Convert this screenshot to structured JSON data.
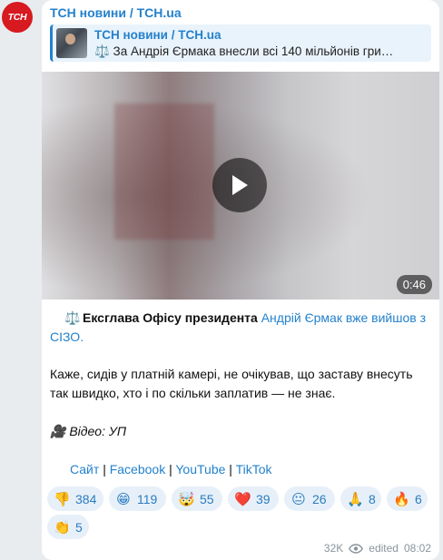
{
  "channel": {
    "avatar_text": "ТСН",
    "name": "ТСН новини / TCH.ua",
    "brand_color": "#d71920",
    "accent_color": "#2481cc"
  },
  "reply": {
    "title": "ТСН новини / TCH.ua",
    "text": "⚖️ За Андрія Єрмака внесли всі 140 мільйонів гри…"
  },
  "video": {
    "duration": "0:46",
    "play_icon": "play-icon"
  },
  "caption": {
    "line1_emoji": "⚖️",
    "line1_bold": "Ексглава Офісу президента",
    "line1_link": "Андрій Єрмак вже вийшов з СІЗО.",
    "paragraph": "Каже, сидів у платній камері, не очікував, що заставу внесуть так швидко, хто і по скільки заплатив — не знає.",
    "video_emoji": "🎥",
    "video_credit": "Відео: УП",
    "links": [
      "Сайт",
      "Facebook",
      "YouTube",
      "TikTok"
    ],
    "separator": "|"
  },
  "reactions": [
    {
      "emoji": "👎",
      "count": "384"
    },
    {
      "emoji": "😁",
      "count": "119"
    },
    {
      "emoji": "🤯",
      "count": "55"
    },
    {
      "emoji": "❤️",
      "count": "39"
    },
    {
      "emoji": "😐",
      "count": "26"
    },
    {
      "emoji": "🙏",
      "count": "8"
    },
    {
      "emoji": "🔥",
      "count": "6"
    },
    {
      "emoji": "👏",
      "count": "5"
    }
  ],
  "meta": {
    "views": "32K",
    "edited_label": "edited",
    "time": "08:02"
  }
}
